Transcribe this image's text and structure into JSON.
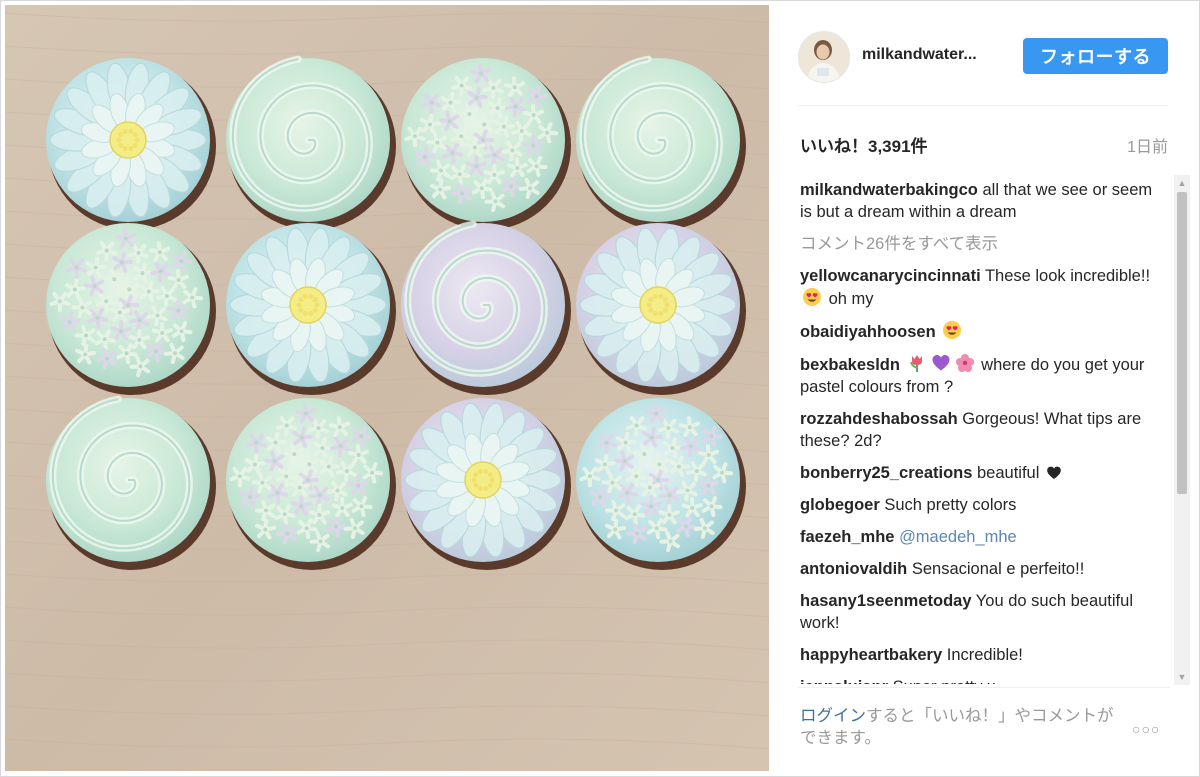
{
  "post": {
    "username": "milkandwater...",
    "follow_label": "フォローする",
    "likes": "いいね！3,391件",
    "time_ago": "1日前"
  },
  "caption": {
    "user": "milkandwaterbakingco",
    "text": " all that we see or seem is but a dream within a dream"
  },
  "view_all": "コメント26件をすべて表示",
  "comments": [
    {
      "user": "yellowcanarycincinnati",
      "before": " These look incredible!! ",
      "emoji": [
        "heart-eyes-emoji"
      ],
      "after": " oh my"
    },
    {
      "user": "obaidiyahhoosen",
      "before": " ",
      "emoji": [
        "heart-eyes-emoji"
      ],
      "after": ""
    },
    {
      "user": "bexbakesldn",
      "before": " ",
      "emoji": [
        "tulip-emoji",
        "purple-heart-emoji",
        "hibiscus-emoji"
      ],
      "after": " where do you get your pastel colours from ?"
    },
    {
      "user": "rozzahdeshabossah",
      "before": " Gorgeous! What tips are these? 2d?",
      "emoji": [],
      "after": ""
    },
    {
      "user": "bonberry25_creations",
      "before": " beautiful ",
      "emoji": [
        "black-heart-emoji"
      ],
      "after": ""
    },
    {
      "user": "globegoer",
      "before": " Such pretty colors",
      "emoji": [],
      "after": ""
    },
    {
      "user": "faezeh_mhe",
      "before": " ",
      "mention": "@maedeh_mhe",
      "emoji": [],
      "after": ""
    },
    {
      "user": "antoniovaldih",
      "before": " Sensacional e perfeito!!",
      "emoji": [],
      "after": ""
    },
    {
      "user": "hasany1seenmetoday",
      "before": " You do such beautiful work!",
      "emoji": [],
      "after": ""
    },
    {
      "user": "happyheartbakery",
      "before": " Incredible!",
      "emoji": [],
      "after": ""
    },
    {
      "user": "jennaluianr",
      "before": " Super pretty x",
      "emoji": [],
      "after": ""
    }
  ],
  "footer": {
    "login": "ログイン",
    "rest": "すると「いいね！」やコメントができます。",
    "more_icon": "more-options-icon"
  },
  "colors": {
    "accent": "#3897f0",
    "photo_background": "#d2c2b2",
    "frosting_mint": "#cfe9dc",
    "frosting_blue": "#bfe3e5",
    "frosting_lavender": "#d8d2e6",
    "flower_center": "#f4ec85"
  },
  "photo": {
    "subject": "12 pastel frosted cupcakes in a 4x3 grid",
    "cupcakes": [
      [
        "flower",
        "rose",
        "hydrangea",
        "rose"
      ],
      [
        "hydrangea",
        "flower",
        "rose",
        "flower"
      ],
      [
        "rose",
        "hydrangea",
        "flower",
        "hydrangea"
      ]
    ]
  }
}
